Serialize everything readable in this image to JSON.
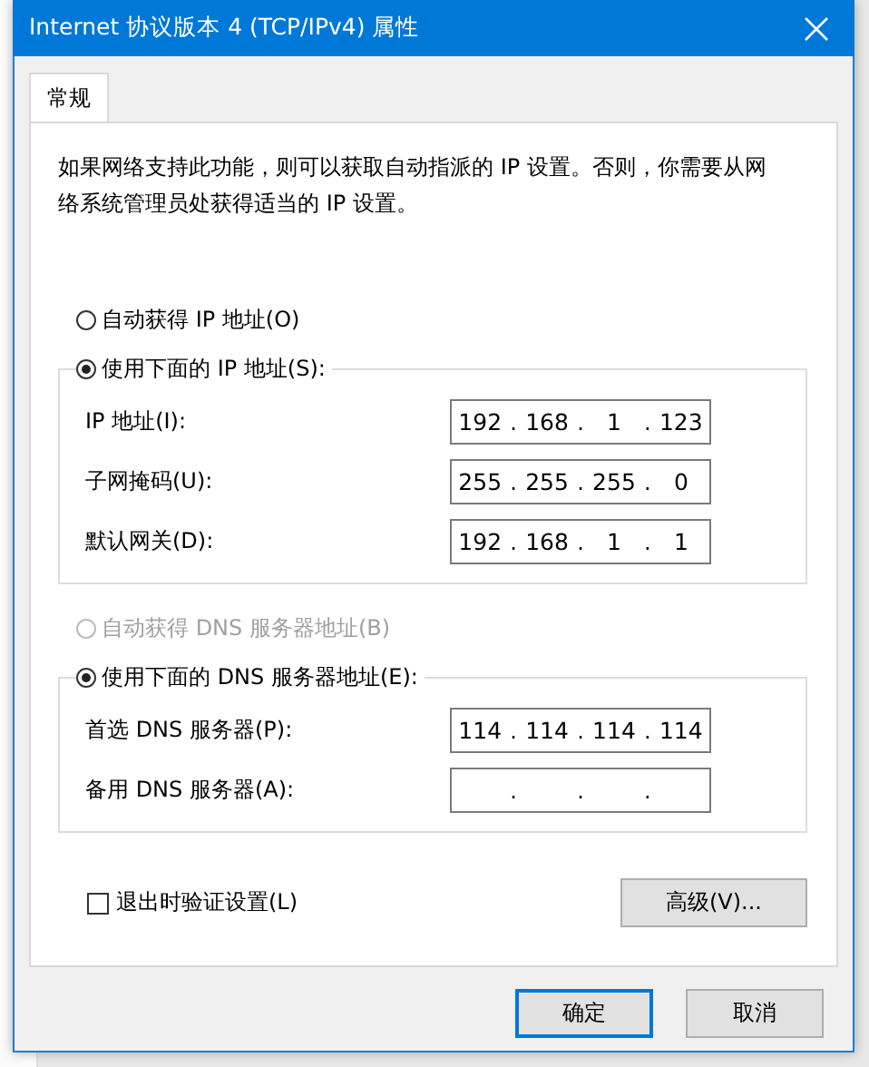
{
  "window": {
    "title": "Internet 协议版本 4 (TCP/IPv4) 属性"
  },
  "tabs": [
    {
      "label": "常规",
      "selected": true
    }
  ],
  "description": "如果网络支持此功能，则可以获取自动指派的 IP 设置。否则，你需要从网络系统管理员处获得适当的 IP 设置。",
  "octet_separator": ".",
  "ip_options": [
    {
      "label": "自动获得 IP 地址(O)",
      "selected": false,
      "disabled": false
    },
    {
      "label": "使用下面的 IP 地址(S):",
      "selected": true,
      "disabled": false
    }
  ],
  "ip_fields": [
    {
      "label": "IP 地址(I):",
      "octets": [
        "192",
        "168",
        "1",
        "123"
      ]
    },
    {
      "label": "子网掩码(U):",
      "octets": [
        "255",
        "255",
        "255",
        "0"
      ]
    },
    {
      "label": "默认网关(D):",
      "octets": [
        "192",
        "168",
        "1",
        "1"
      ]
    }
  ],
  "dns_options": [
    {
      "label": "自动获得 DNS 服务器地址(B)",
      "selected": false,
      "disabled": true
    },
    {
      "label": "使用下面的 DNS 服务器地址(E):",
      "selected": true,
      "disabled": false
    }
  ],
  "dns_fields": [
    {
      "label": "首选 DNS 服务器(P):",
      "octets": [
        "114",
        "114",
        "114",
        "114"
      ]
    },
    {
      "label": "备用 DNS 服务器(A):"
    }
  ],
  "validate_checkbox": {
    "label": "退出时验证设置(L)",
    "checked": false
  },
  "advanced_button": "高级(V)...",
  "buttons": [
    {
      "label": "确定",
      "default": true
    },
    {
      "label": "取消",
      "default": false
    }
  ]
}
